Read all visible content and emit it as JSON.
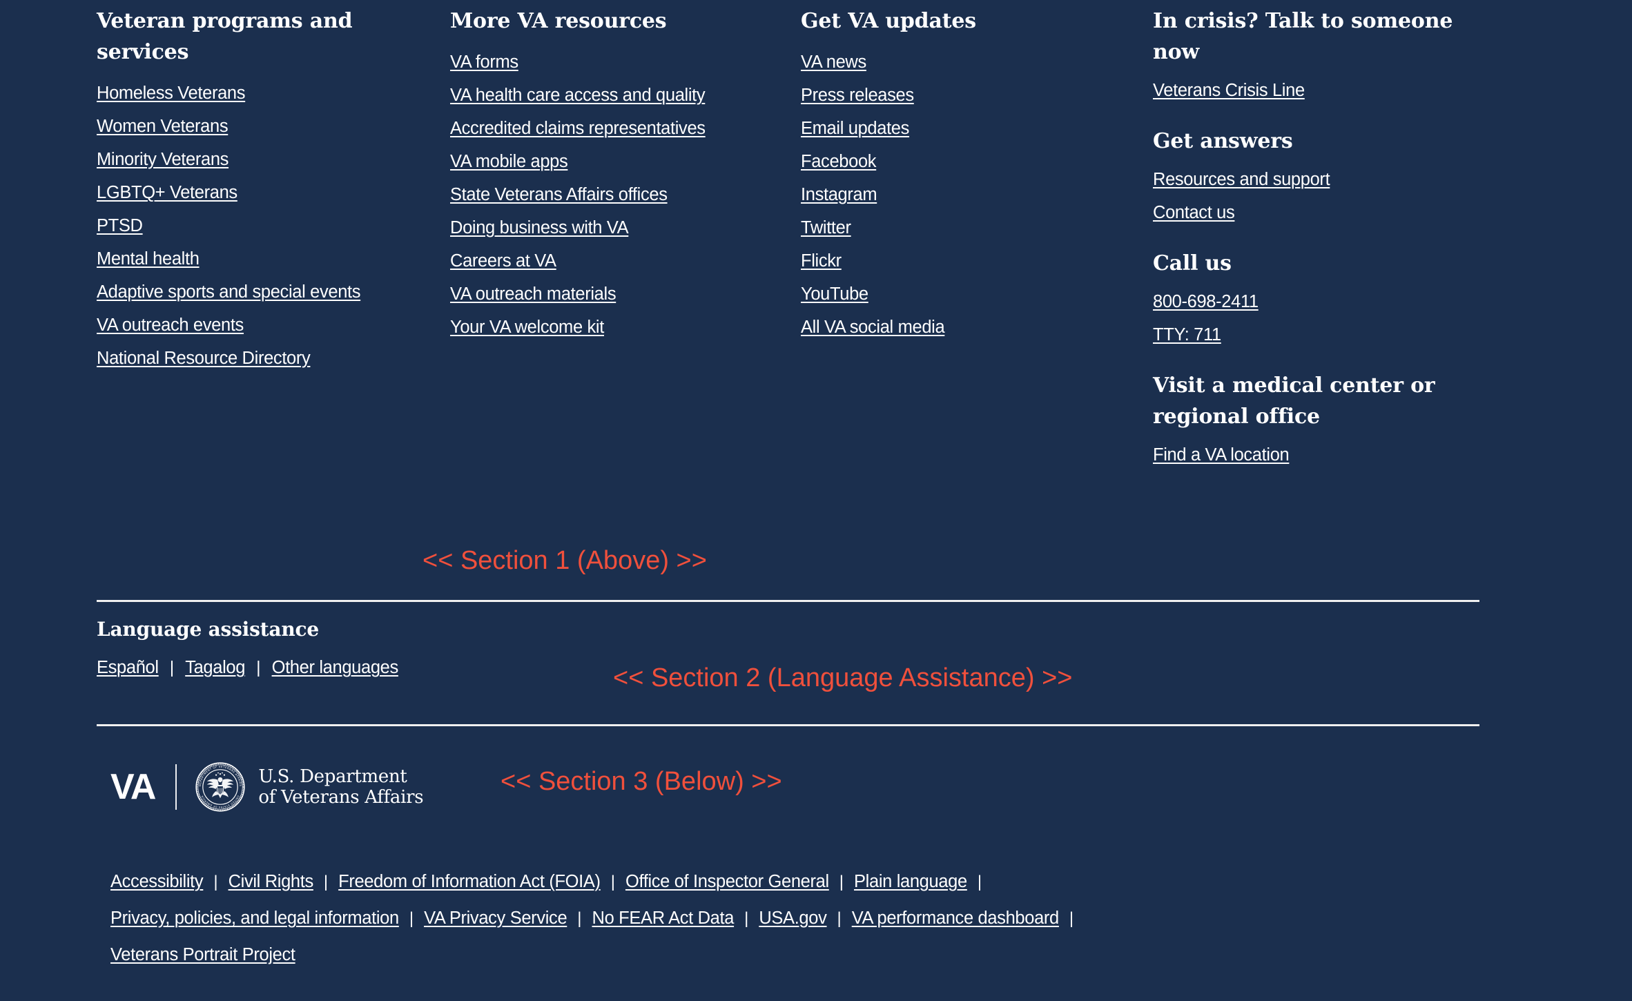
{
  "colors": {
    "background": "#1b2f4e",
    "text": "#ffffff",
    "annotation": "#f0503c",
    "divider": "#f0f0f0"
  },
  "section1": {
    "columns": [
      {
        "heading": "Veteran programs and services",
        "links": [
          "Homeless Veterans",
          "Women Veterans",
          "Minority Veterans",
          "LGBTQ+ Veterans",
          "PTSD",
          "Mental health",
          "Adaptive sports and special events",
          "VA outreach events",
          "National Resource Directory"
        ]
      },
      {
        "heading": "More VA resources",
        "links": [
          "VA forms",
          "VA health care access and quality",
          "Accredited claims representatives",
          "VA mobile apps",
          "State Veterans Affairs offices",
          "Doing business with VA",
          "Careers at VA",
          "VA outreach materials",
          "Your VA welcome kit"
        ]
      },
      {
        "heading": "Get VA updates",
        "links": [
          "VA news",
          "Press releases",
          "Email updates",
          "Facebook",
          "Instagram",
          "Twitter",
          "Flickr",
          "YouTube",
          "All VA social media"
        ]
      }
    ],
    "crisis_column": {
      "heading_crisis": "In crisis? Talk to someone now",
      "link_crisis": "Veterans Crisis Line",
      "heading_answers": "Get answers",
      "links_answers": [
        "Resources and support",
        "Contact us"
      ],
      "heading_call": "Call us",
      "links_call": [
        "800-698-2411",
        "TTY: 711"
      ],
      "heading_visit": "Visit a medical center or regional office",
      "link_visit": "Find a VA location"
    },
    "annotation": "<< Section 1 (Above) >>"
  },
  "section2": {
    "heading": "Language assistance",
    "links": [
      "Español",
      "Tagalog",
      "Other languages"
    ],
    "separator": "|",
    "annotation": "<< Section 2 (Language Assistance) >>"
  },
  "section3": {
    "annotation": "<< Section 3 (Below) >>",
    "logo": {
      "wordmark": "VA",
      "seal_icon": "va-seal-icon",
      "agency_line1": "U.S. Department",
      "agency_line2": "of Veterans Affairs",
      "seal_text_top": "DEPARTMENT OF VETERANS AFFAIRS",
      "seal_text_bottom": "UNITED STATES OF AMERICA"
    },
    "bottom_rows": [
      [
        "Accessibility",
        "Civil Rights",
        "Freedom of Information Act (FOIA)",
        "Office of Inspector General",
        "Plain language"
      ],
      [
        "Privacy, policies, and legal information",
        "VA Privacy Service",
        "No FEAR Act Data",
        "USA.gov",
        "VA performance dashboard"
      ],
      [
        "Veterans Portrait Project"
      ]
    ],
    "separator": "|"
  }
}
